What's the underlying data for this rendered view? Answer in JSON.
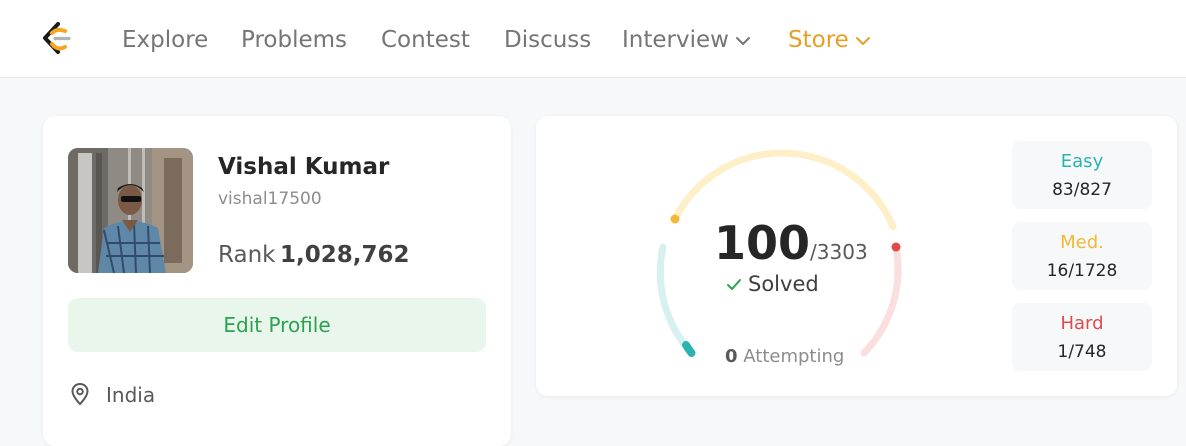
{
  "nav": {
    "items": [
      "Explore",
      "Problems",
      "Contest",
      "Discuss",
      "Interview"
    ],
    "store_label": "Store",
    "colors": {
      "store": "#e5a025",
      "text": "#757575"
    }
  },
  "profile": {
    "name": "Vishal Kumar",
    "username": "vishal17500",
    "rank_label": "Rank",
    "rank_value": "1,028,762",
    "edit_button": "Edit Profile",
    "location": "India"
  },
  "stats": {
    "solved": "100",
    "total": "/3303",
    "solved_label": "Solved",
    "attempting_count": "0",
    "attempting_label": "Attempting",
    "difficulties": [
      {
        "label": "Easy",
        "value": "83/827",
        "color": "#2bb3b1"
      },
      {
        "label": "Med.",
        "value": "16/1728",
        "color": "#f4b834"
      },
      {
        "label": "Hard",
        "value": "1/748",
        "color": "#e04a4a"
      }
    ]
  }
}
